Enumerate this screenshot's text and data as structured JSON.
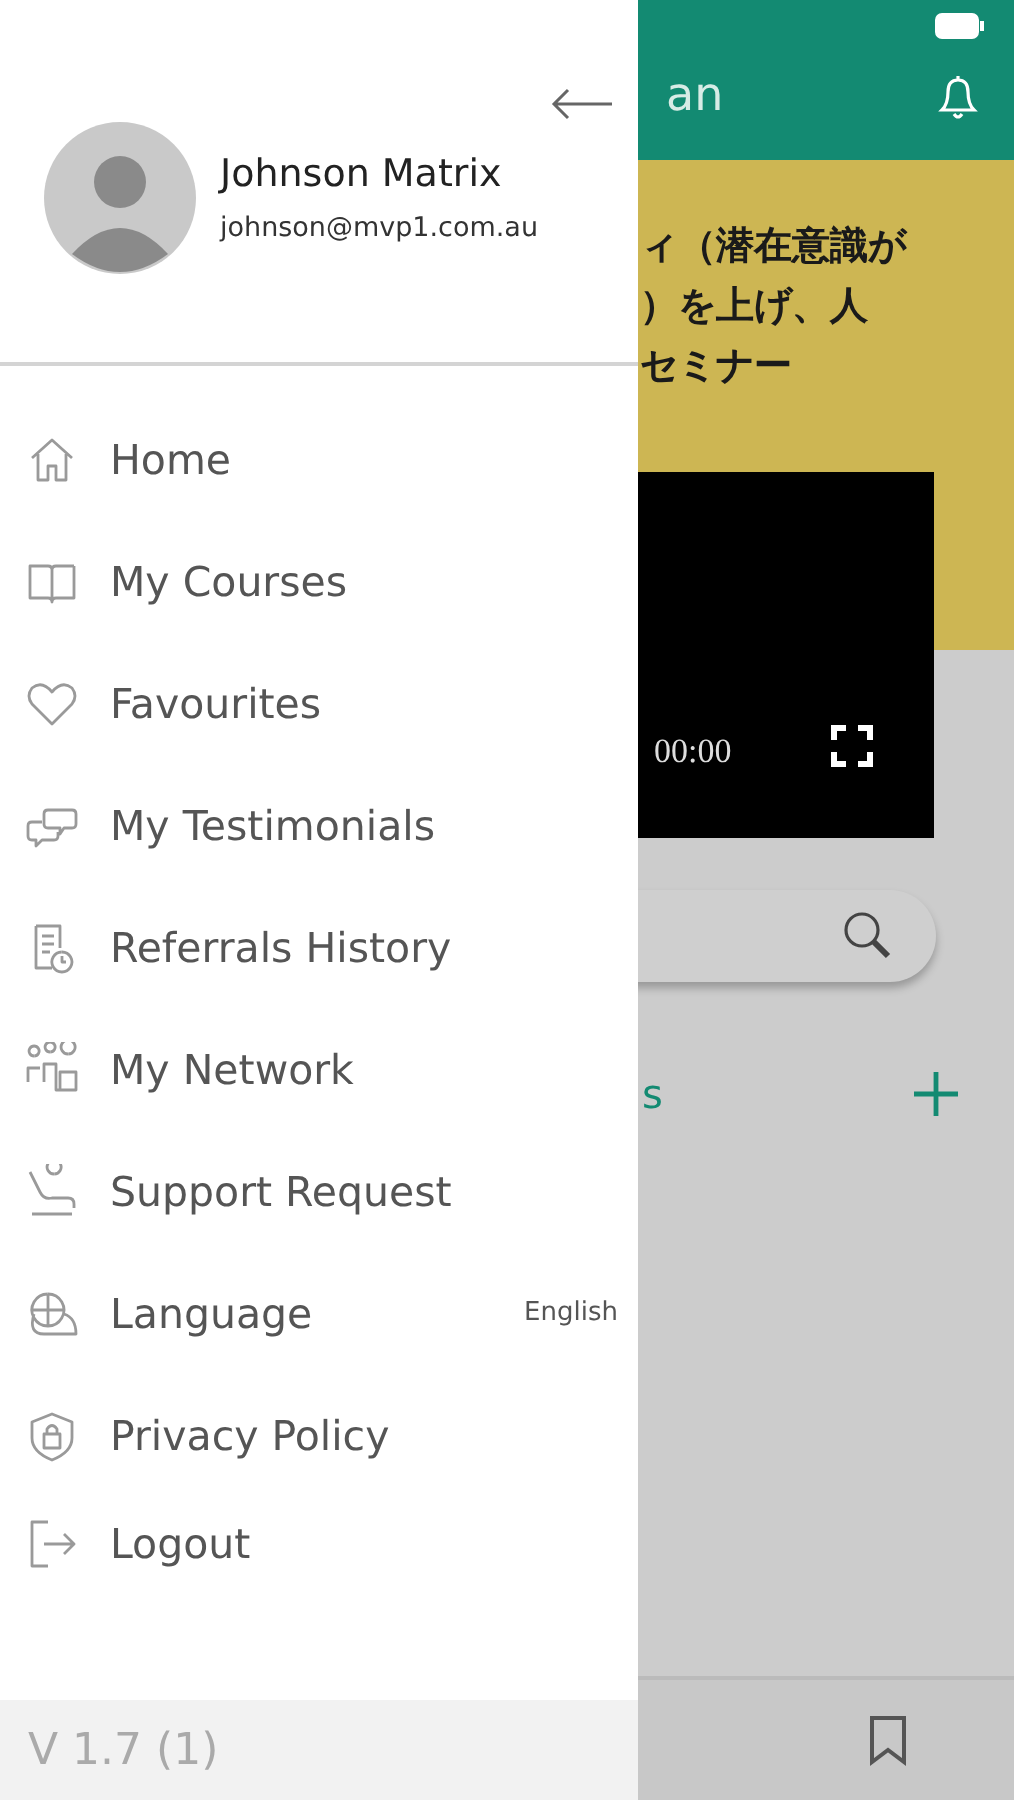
{
  "app_header": {
    "title": "an"
  },
  "banner": {
    "lines": [
      "ィ（潜在意識が",
      "）を上げ、人",
      "セミナー"
    ]
  },
  "video": {
    "time": "00:00"
  },
  "section": {
    "title": "s"
  },
  "drawer": {
    "user": {
      "name": "Johnson Matrix",
      "email": "johnson@mvp1.com.au"
    },
    "items": [
      {
        "label": "Home"
      },
      {
        "label": "My Courses"
      },
      {
        "label": "Favourites"
      },
      {
        "label": "My Testimonials"
      },
      {
        "label": "Referrals History"
      },
      {
        "label": "My Network"
      },
      {
        "label": "Support Request"
      },
      {
        "label": "Language",
        "value": "English"
      },
      {
        "label": "Privacy Policy"
      },
      {
        "label": "Logout"
      }
    ],
    "version": "V 1.7 (1)"
  }
}
